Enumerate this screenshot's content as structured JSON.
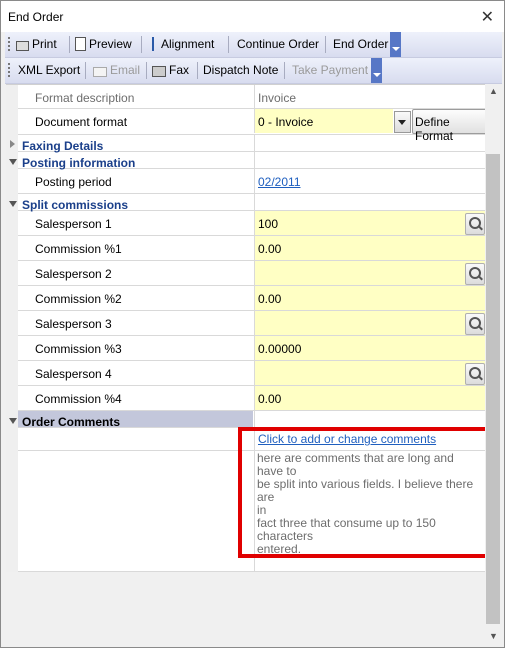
{
  "window": {
    "title": "End Order",
    "close_glyph": "✕"
  },
  "toolbar1": {
    "print": "Print",
    "preview": "Preview",
    "alignment": "Alignment",
    "continue_order": "Continue Order",
    "end_order": "End Order"
  },
  "toolbar2": {
    "xml_export": "XML Export",
    "email": "Email",
    "fax": "Fax",
    "dispatch_note": "Dispatch Note",
    "take_payment": "Take Payment"
  },
  "grid": {
    "format_description": {
      "label": "Format description",
      "value": "Invoice"
    },
    "document_format": {
      "label": "Document format",
      "value": "0 - Invoice",
      "define_button": "Define Format"
    },
    "faxing_details": "Faxing Details",
    "posting_information": "Posting information",
    "posting_period": {
      "label": "Posting period",
      "value": "02/2011"
    },
    "split_commissions": "Split commissions",
    "salesperson1": {
      "label": "Salesperson 1",
      "value": "100"
    },
    "commission1": {
      "label": "Commission %1",
      "value": "0.00"
    },
    "salesperson2": {
      "label": "Salesperson 2",
      "value": ""
    },
    "commission2": {
      "label": "Commission %2",
      "value": "0.00"
    },
    "salesperson3": {
      "label": "Salesperson 3",
      "value": ""
    },
    "commission3": {
      "label": "Commission %3",
      "value": "0.00000"
    },
    "salesperson4": {
      "label": "Salesperson 4",
      "value": ""
    },
    "commission4": {
      "label": "Commission %4",
      "value": "0.00"
    },
    "order_comments": "Order Comments",
    "comments_link": "Click to add or change comments",
    "comments_lines": [
      "here are comments that are long and have to",
      "be split into various fields. I believe there are",
      "in",
      "fact three that consume up to 150 characters",
      "entered."
    ]
  },
  "colors": {
    "highlight_border": "#e00000",
    "field_yellow": "#ffffc4",
    "category_text": "#1a3f8a"
  }
}
